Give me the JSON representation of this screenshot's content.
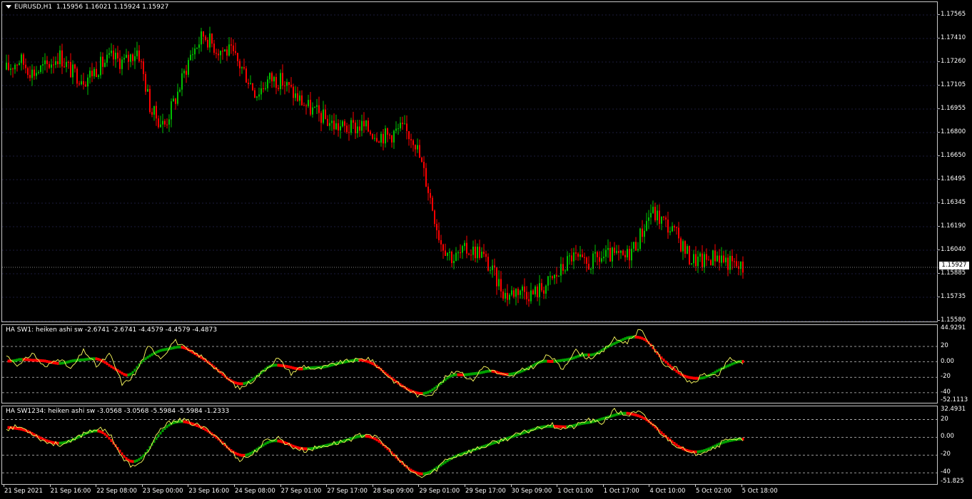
{
  "main": {
    "symbol_label": "EURUSD,H1",
    "ohlc": "1.15956 1.16021 1.15924 1.15927",
    "price_labels": [
      "1.17565",
      "1.17410",
      "1.17260",
      "1.17105",
      "1.16955",
      "1.16800",
      "1.16650",
      "1.16495",
      "1.16345",
      "1.16190",
      "1.16040",
      "1.15885",
      "1.15735",
      "1.15580"
    ],
    "current_price": "1.15927",
    "colors": {
      "up": "#00c000",
      "down": "#ff0000",
      "bg": "#000000",
      "grid": "#1c1c3c"
    }
  },
  "indicator1": {
    "label": "HA SW1: heiken ashi sw -2.6741 -2.6741 -4.4579 -4.4579 -4.4873",
    "levels": [
      "44.9291",
      "20",
      "0.00",
      "-20",
      "-40",
      "-52.1113"
    ],
    "dashed_levels": [
      20,
      0,
      -20,
      -40
    ]
  },
  "indicator2": {
    "label": "HA SW1234: heiken ashi sw -3.0568 -3.0568 -5.5984 -5.5984 -1.2333",
    "levels": [
      "32.4931",
      "20",
      "0.00",
      "-20",
      "-40",
      "-51.825"
    ],
    "dashed_levels": [
      20,
      0,
      -20,
      -40
    ]
  },
  "time_labels": [
    "21 Sep 2021",
    "21 Sep 16:00",
    "22 Sep 08:00",
    "23 Sep 00:00",
    "23 Sep 16:00",
    "24 Sep 08:00",
    "27 Sep 01:00",
    "27 Sep 17:00",
    "28 Sep 09:00",
    "29 Sep 01:00",
    "29 Sep 17:00",
    "30 Sep 09:00",
    "1 Oct 01:00",
    "1 Oct 17:00",
    "4 Oct 10:00",
    "5 Oct 02:00",
    "5 Oct 18:00"
  ],
  "chart_data": {
    "type": "candlestick",
    "x_start": "21 Sep 2021",
    "x_end": "5 Oct 18:00",
    "ylim": [
      1.1558,
      1.1765
    ],
    "close_path": [
      1.1728,
      1.1735,
      1.1726,
      1.173,
      1.1738,
      1.1726,
      1.1722,
      1.173,
      1.1736,
      1.1733,
      1.1742,
      1.17,
      1.169,
      1.1712,
      1.1738,
      1.1752,
      1.1742,
      1.174,
      1.1728,
      1.1712,
      1.1722,
      1.172,
      1.171,
      1.1702,
      1.1696,
      1.169,
      1.1688,
      1.169,
      1.1685,
      1.1683,
      1.1688,
      1.1682,
      1.165,
      1.1612,
      1.16,
      1.1606,
      1.1605,
      1.159,
      1.1575,
      1.158,
      1.1576,
      1.1582,
      1.159,
      1.1602,
      1.1595,
      1.16,
      1.1602,
      1.16,
      1.1612,
      1.1632,
      1.1625,
      1.1615,
      1.16,
      1.1598,
      1.1603,
      1.1597,
      1.1593
    ],
    "indicator1_line": [
      8,
      -5,
      12,
      -8,
      6,
      -10,
      15,
      -6,
      10,
      -30,
      -15,
      20,
      5,
      28,
      15,
      8,
      -5,
      -20,
      -35,
      -25,
      -10,
      5,
      -15,
      -5,
      -10,
      -5,
      0,
      2,
      5,
      -10,
      -25,
      -35,
      -45,
      -40,
      -20,
      -10,
      -25,
      -5,
      -15,
      -20,
      -10,
      -5,
      10,
      -10,
      15,
      5,
      10,
      30,
      25,
      42,
      20,
      -5,
      -10,
      -30,
      -15,
      -20,
      5,
      -4
    ],
    "indicator2_line": [
      10,
      12,
      5,
      -5,
      -8,
      -6,
      5,
      10,
      5,
      -25,
      -35,
      -15,
      10,
      20,
      18,
      12,
      5,
      -10,
      -25,
      -20,
      -5,
      0,
      -10,
      -15,
      -12,
      -8,
      -5,
      0,
      5,
      -5,
      -20,
      -35,
      -45,
      -40,
      -25,
      -20,
      -15,
      -10,
      -5,
      0,
      5,
      10,
      15,
      10,
      12,
      20,
      15,
      30,
      25,
      28,
      15,
      0,
      -10,
      -20,
      -15,
      -10,
      0,
      -4
    ]
  }
}
